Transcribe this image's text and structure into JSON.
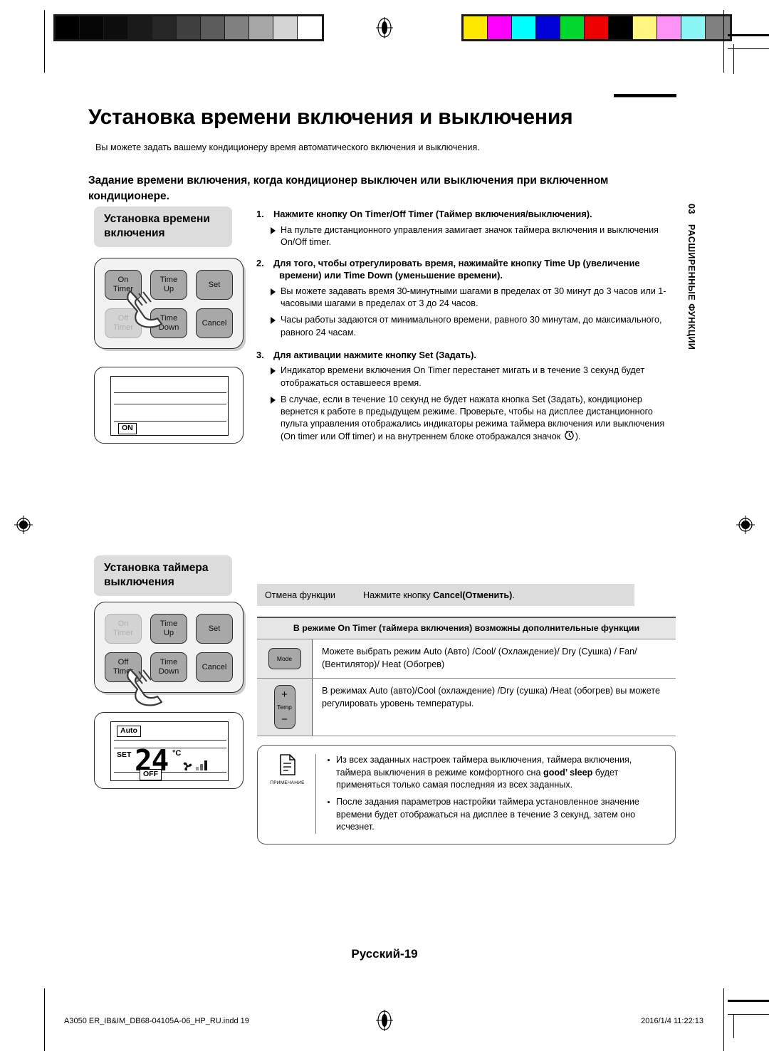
{
  "calibration": {
    "grayscale": [
      "#000000",
      "#050505",
      "#0d0d0d",
      "#1a1a1a",
      "#262626",
      "#404040",
      "#5c5c5c",
      "#808080",
      "#a6a6a6",
      "#d4d4d4",
      "#ffffff"
    ],
    "colors": [
      "#ffe800",
      "#ff00ff",
      "#00ffff",
      "#0000d8",
      "#00d830",
      "#ee0000",
      "#000000",
      "#fff57f",
      "#ff92f5",
      "#8cf5f5",
      "#808080"
    ]
  },
  "header": {
    "title": "Установка времени включения и выключения",
    "intro": "Вы можете задать вашему кондиционеру время автоматического включения и выключения.",
    "subhead": "Задание времени включения, когда кондиционер выключен или выключения при включенном кондиционере."
  },
  "chapter_tab": {
    "number": "03",
    "label": "РАСШИРЕННЫЕ ФУНКЦИИ"
  },
  "diagrams": [
    {
      "id": "on-timer",
      "label": "Установка времени включения",
      "buttons": [
        {
          "line1": "On",
          "line2": "Timer",
          "dim": false
        },
        {
          "line1": "Time",
          "line2": "Up",
          "dim": false
        },
        {
          "line1": "Set",
          "line2": "",
          "dim": false
        },
        {
          "line1": "Off",
          "line2": "Timer",
          "dim": true
        },
        {
          "line1": "Time",
          "line2": "Down",
          "dim": false
        },
        {
          "line1": "Cancel",
          "line2": "",
          "dim": false
        }
      ],
      "lcd": {
        "mode": "",
        "set_label": "",
        "temp": "",
        "unit": "",
        "state": "ON"
      }
    },
    {
      "id": "off-timer",
      "label": "Установка таймера выключения",
      "buttons": [
        {
          "line1": "On",
          "line2": "Timer",
          "dim": true
        },
        {
          "line1": "Time",
          "line2": "Up",
          "dim": false
        },
        {
          "line1": "Set",
          "line2": "",
          "dim": false
        },
        {
          "line1": "Off",
          "line2": "Timer",
          "dim": false
        },
        {
          "line1": "Time",
          "line2": "Down",
          "dim": false
        },
        {
          "line1": "Cancel",
          "line2": "",
          "dim": false
        }
      ],
      "lcd": {
        "mode": "Auto",
        "set_label": "SET",
        "temp": "24",
        "unit": "°C",
        "state": "OFF"
      }
    }
  ],
  "steps": [
    {
      "num": "1.",
      "text": "Нажмите кнопку On Timer/Off Timer (Таймер включения/выключения).",
      "bullets": [
        "На пульте дистанционного управления замигает значок таймера включения и выключения On/Off timer."
      ]
    },
    {
      "num": "2.",
      "text": "Для того, чтобы отрегулировать время, нажимайте кнопку Time Up (увеличение времени) или Time Down  (уменьшение времени).",
      "bullets": [
        "Вы можете задавать время 30-минутными шагами в пределах от 30 минут до 3 часов или 1-часовыми шагами в пределах от 3 до 24 часов.",
        "Часы работы задаются от минимального времени, равного 30 минутам, до максимального, равного 24 часам."
      ]
    },
    {
      "num": "3.",
      "text": "Для активации нажмите кнопку Set (Задать).",
      "bullets": [
        "Индикатор времени включения On Timer перестанет мигать и в течение 3 секунд будет отображаться оставшееся время."
      ],
      "bullet_with_icon": {
        "before": "В случае, если в течение 10 секунд не будет нажата кнопка Set (Задать), кондиционер вернется к работе в предыдущем режиме. Проверьте, чтобы на дисплее дистанционного пульта управления  отображались индикаторы режима таймера включения или выключения (On timer или Off timer) и на внутреннем блоке отображался значок ",
        "icon": "clock-icon",
        "after": ")."
      }
    }
  ],
  "cancel_bar": {
    "label": "Отмена функции",
    "action_prefix": "Нажмите кнопку ",
    "action_bold": "Cancel(Отменить)",
    "action_suffix": "."
  },
  "function_table": {
    "header": "В режиме On Timer (таймера включения) возможны дополнительные функции",
    "rows": [
      {
        "icon": "mode-button-icon",
        "icon_label": "Mode",
        "text": "Можете выбрать режим Auto (Авто) /Cool/ (Охлаждение)/ Dry (Сушка) / Fan/ (Вентилятор)/ Heat (Обогрев)"
      },
      {
        "icon": "temp-button-icon",
        "icon_label": "Temp",
        "icon_plus": "+",
        "icon_minus": "−",
        "text": "В режимах Auto (авто)/Cool (охлаждение) /Dry (сушка) /Heat (обогрев) вы можете регулировать уровень температуры."
      }
    ]
  },
  "note": {
    "icon_caption": "ПРИМЕЧАНИЕ",
    "items": [
      {
        "before": "Из всех заданных настроек таймера выключения, таймера включения, таймера выключения в режиме комфортного сна ",
        "bold": "good’ sleep",
        "after": " будет применяться только самая последняя из всех заданных."
      },
      {
        "before": "После задания параметров настройки таймера установленное значение времени будет отображаться на дисплее в течение 3 секунд, затем оно исчезнет.",
        "bold": "",
        "after": ""
      }
    ]
  },
  "footer": {
    "page_label": "Русский-19",
    "file": "A3050 ER_IB&IM_DB68-04105A-06_HP_RU.indd   19",
    "date": "2016/1/4   11:22:13"
  }
}
